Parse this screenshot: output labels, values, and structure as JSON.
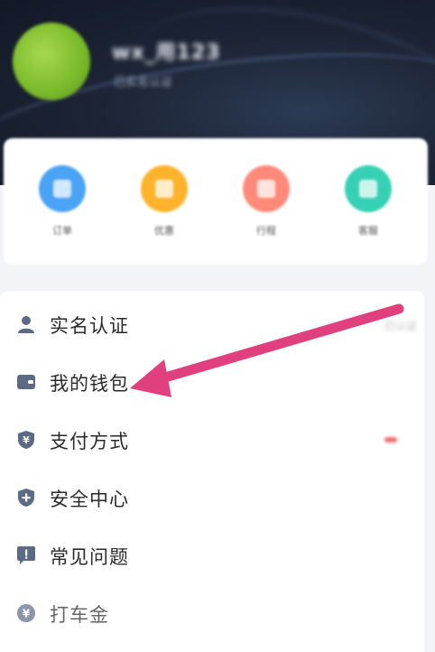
{
  "header": {
    "username": "wx_用123",
    "subline": "已实名认证"
  },
  "quick_actions": [
    {
      "label": "订单",
      "color": "#4aa3f5"
    },
    {
      "label": "优惠",
      "color": "#ffb32a"
    },
    {
      "label": "行程",
      "color": "#ff8a7a"
    },
    {
      "label": "客服",
      "color": "#36d1b5"
    }
  ],
  "menu": [
    {
      "label": "实名认证",
      "icon": "person-icon",
      "right": "已认证"
    },
    {
      "label": "我的钱包",
      "icon": "wallet-icon",
      "right": ""
    },
    {
      "label": "支付方式",
      "icon": "yuan-shield-icon",
      "right": ""
    },
    {
      "label": "安全中心",
      "icon": "shield-plus-icon",
      "right": ""
    },
    {
      "label": "常见问题",
      "icon": "question-bubble-icon",
      "right": ""
    },
    {
      "label": "打车金",
      "icon": "yuan-coin-icon",
      "right": ""
    }
  ],
  "colors": {
    "header_bg": "#1d2536",
    "arrow": "#e0407d",
    "icon_gray": "#5b6b85"
  }
}
